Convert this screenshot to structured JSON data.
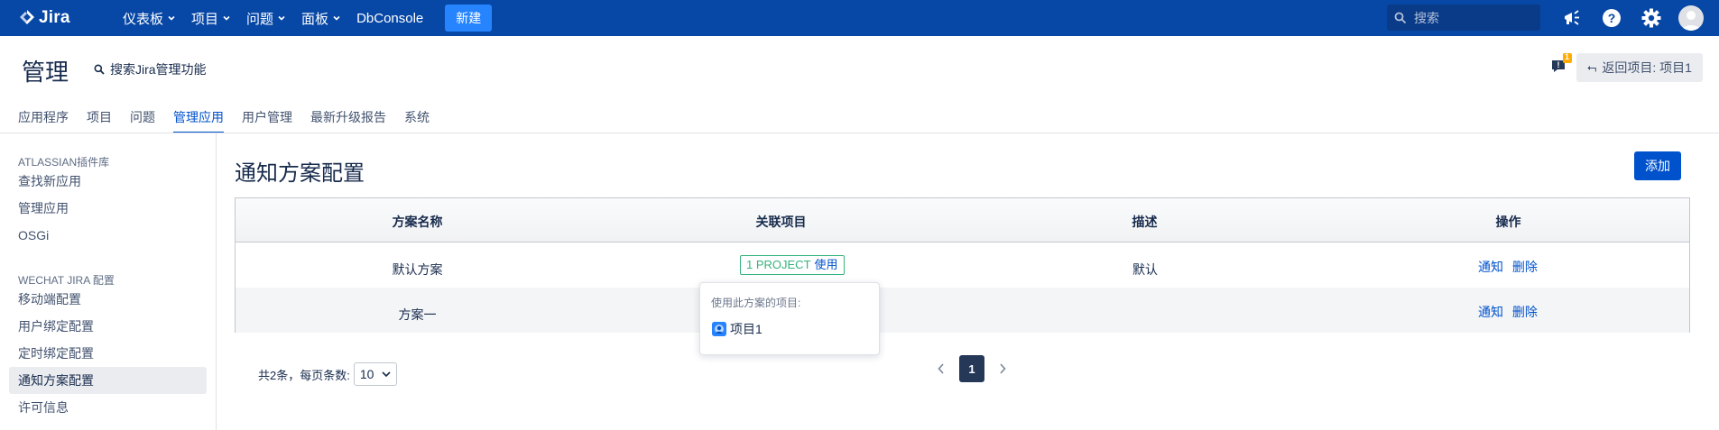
{
  "topnav": {
    "logo_text": "Jira",
    "items": [
      {
        "label": "仪表板"
      },
      {
        "label": "项目"
      },
      {
        "label": "问题"
      },
      {
        "label": "面板"
      }
    ],
    "dbconsole": "DbConsole",
    "create_label": "新建",
    "search_placeholder": "搜索",
    "colors": {
      "bar": "#0747a6",
      "create": "#2684ff"
    }
  },
  "admin": {
    "title": "管理",
    "search_label": "搜索Jira管理功能",
    "feedback_count": "1",
    "back_label": "返回项目: 项目1",
    "tabs": [
      {
        "label": "应用程序"
      },
      {
        "label": "项目"
      },
      {
        "label": "问题"
      },
      {
        "label": "管理应用"
      },
      {
        "label": "用户管理"
      },
      {
        "label": "最新升级报告"
      },
      {
        "label": "系统"
      }
    ],
    "active_tab": "管理应用"
  },
  "sidebar": {
    "sections": [
      {
        "heading": "ATLASSIAN插件库",
        "items": [
          "查找新应用",
          "管理应用",
          "OSGi"
        ]
      },
      {
        "heading": "WECHAT JIRA 配置",
        "items": [
          "移动端配置",
          "用户绑定配置",
          "定时绑定配置",
          "通知方案配置",
          "许可信息"
        ]
      }
    ],
    "selected": "通知方案配置"
  },
  "main": {
    "heading": "通知方案配置",
    "add_label": "添加",
    "columns": [
      "方案名称",
      "关联项目",
      "描述",
      "操作"
    ],
    "rows": [
      {
        "name": "默认方案",
        "projects_count": "1 PROJECT",
        "projects_use": "使用",
        "description": "默认",
        "action_notify": "通知",
        "action_delete": "删除"
      },
      {
        "name": "方案一",
        "projects_count": "",
        "projects_use": "",
        "description": "",
        "action_notify": "通知",
        "action_delete": "删除"
      }
    ],
    "popover": {
      "title": "使用此方案的项目:",
      "project": "项目1"
    },
    "pagination": {
      "summary": "共2条，每页条数:",
      "page_size": "10",
      "current_page": "1"
    }
  }
}
